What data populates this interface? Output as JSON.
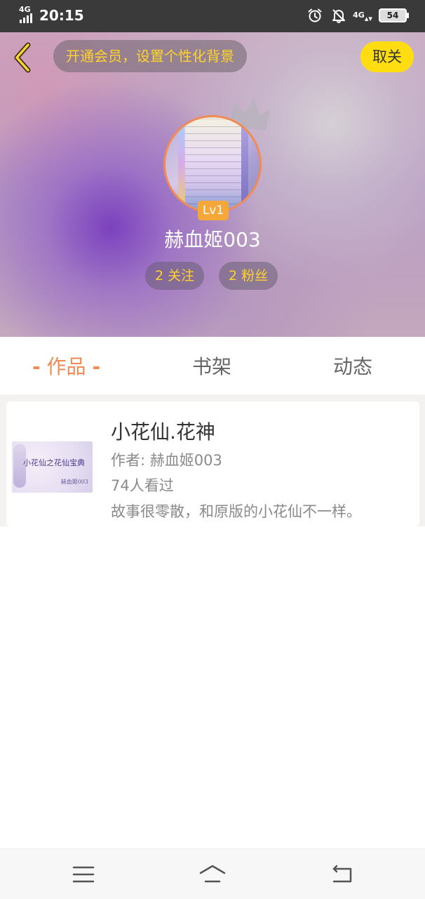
{
  "status_bar": {
    "network": "4G",
    "time": "20:15",
    "icons": [
      "alarm-icon",
      "notifications-muted-icon",
      "4g-data-icon"
    ],
    "data_network": "4G",
    "battery": "54"
  },
  "header": {
    "back_icon": "chevron-left-icon",
    "vip_text": "开通会员，设置个性化背景",
    "follow_button": "取关"
  },
  "profile": {
    "avatar_icon": "crown-icon",
    "level": "Lv1",
    "username": "赫血姬003",
    "stats": [
      {
        "count": "2",
        "label": "关注"
      },
      {
        "count": "2",
        "label": "粉丝"
      }
    ]
  },
  "tabs": [
    {
      "label": "作品",
      "active": true,
      "decoration": "-"
    },
    {
      "label": "书架",
      "active": false
    },
    {
      "label": "动态",
      "active": false
    }
  ],
  "works": [
    {
      "title": "小花仙.花神",
      "author_line": "作者: 赫血姬003",
      "views": "74人看过",
      "description": "故事很零散，和原版的小花仙不一样。",
      "cover_text": "小花仙之花仙宝典",
      "cover_sign": "赫血姬003"
    }
  ],
  "nav": [
    "menu-icon",
    "home-icon",
    "back-icon"
  ],
  "colors": {
    "accent": "#f08b55",
    "highlight": "#ffd32a",
    "follow_button_bg": "#ffdd11",
    "level_badge": "#f5a839"
  }
}
